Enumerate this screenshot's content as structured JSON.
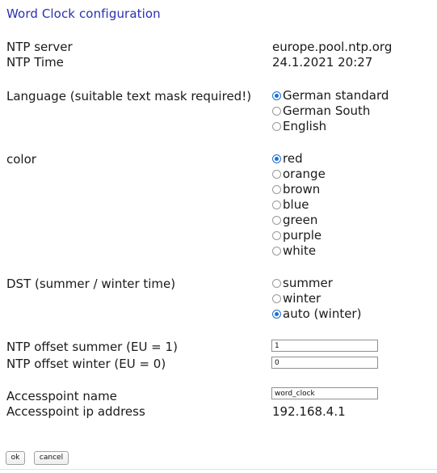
{
  "title": "Word Clock configuration",
  "accent_color": "#2a2fb0",
  "radio_selected_color": "#1675d1",
  "info": {
    "ntp_server_label": "NTP server",
    "ntp_server_value": "europe.pool.ntp.org",
    "ntp_time_label": "NTP Time",
    "ntp_time_value": "24.1.2021 20:27"
  },
  "language": {
    "label": "Language (suitable text mask required!)",
    "options": [
      {
        "label": "German standard",
        "selected": true
      },
      {
        "label": "German South",
        "selected": false
      },
      {
        "label": "English",
        "selected": false
      }
    ]
  },
  "color": {
    "label": "color",
    "options": [
      {
        "label": "red",
        "selected": true
      },
      {
        "label": "orange",
        "selected": false
      },
      {
        "label": "brown",
        "selected": false
      },
      {
        "label": "blue",
        "selected": false
      },
      {
        "label": "green",
        "selected": false
      },
      {
        "label": "purple",
        "selected": false
      },
      {
        "label": "white",
        "selected": false
      }
    ]
  },
  "dst": {
    "label": "DST (summer / winter time)",
    "options": [
      {
        "label": "summer",
        "selected": false
      },
      {
        "label": "winter",
        "selected": false
      },
      {
        "label": "auto (winter)",
        "selected": true
      }
    ]
  },
  "offsets": {
    "summer_label": "NTP offset summer (EU = 1)",
    "summer_value": "1",
    "winter_label": "NTP offset winter (EU = 0)",
    "winter_value": "0"
  },
  "accesspoint": {
    "name_label": "Accesspoint name",
    "name_value": "word_clock",
    "ip_label": "Accesspoint ip address",
    "ip_value": "192.168.4.1"
  },
  "buttons": {
    "ok": "ok",
    "cancel": "cancel"
  }
}
